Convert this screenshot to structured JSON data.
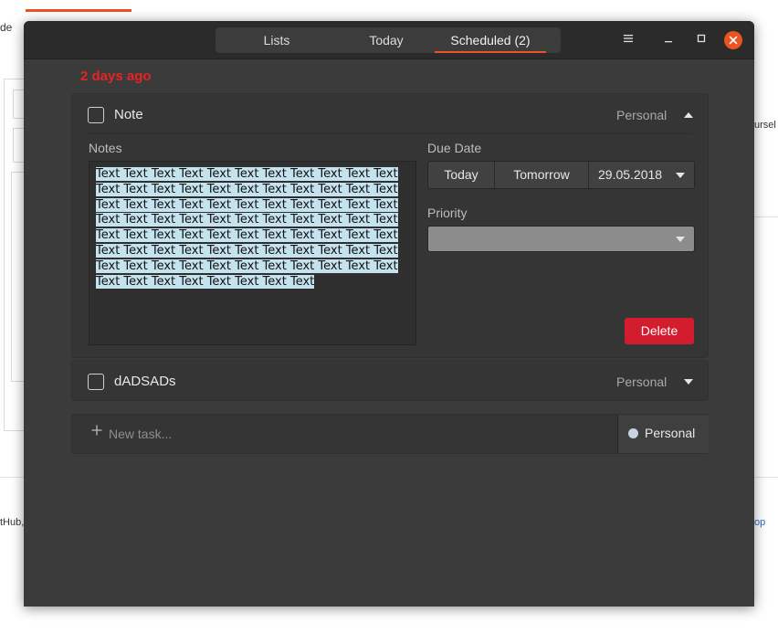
{
  "background_page": {
    "left_text_top": "de",
    "left_text_bottom": "tHub,",
    "right_text_top": "ursel",
    "right_link": "op"
  },
  "window": {
    "tabs": [
      {
        "label": "Lists"
      },
      {
        "label": "Today"
      },
      {
        "label": "Scheduled (2)",
        "active": true
      }
    ],
    "menu_icon": "hamburger-menu-icon",
    "minimize_icon": "minimize-icon",
    "maximize_icon": "maximize-icon",
    "close_icon": "close-icon",
    "accent_color": "#e95420"
  },
  "schedule": {
    "date_heading": "2 days ago",
    "date_heading_color": "#e82323",
    "tasks": [
      {
        "title": "Note",
        "list": "Personal",
        "expanded": true,
        "notes_label": "Notes",
        "notes": "Text Text Text Text Text Text Text Text Text Text Text Text Text Text Text Text Text Text Text Text Text Text Text Text Text Text Text Text Text Text Text Text Text Text Text Text Text Text Text Text Text Text Text Text Text Text Text Text Text Text Text Text Text Text Text Text Text Text Text Text Text Text Text Text Text Text Text Text Text Text Text Text Text Text Text Text Text Text Text Text Text Text Text Text Text",
        "due_date_label": "Due Date",
        "today_button": "Today",
        "tomorrow_button": "Tomorrow",
        "due_date": "29.05.2018",
        "priority_label": "Priority",
        "priority_value": "",
        "delete_button": "Delete"
      },
      {
        "title": "dADSADs",
        "list": "Personal",
        "expanded": false
      }
    ],
    "new_task": {
      "placeholder": "New task...",
      "list": "Personal",
      "list_color": "#c8d4e3"
    }
  }
}
